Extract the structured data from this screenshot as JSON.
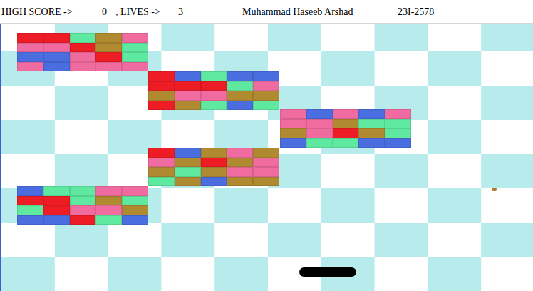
{
  "hud": {
    "high_score_label": "HIGH SCORE ->",
    "high_score": "0",
    "lives_label": ", LIVES ->",
    "lives": "3",
    "player_name": "Muhammad Haseeb Arshad",
    "player_id": "23I-2578"
  },
  "brick_groups": [
    {
      "rows": [
        [
          {
            "color": "#ee1c24"
          },
          {
            "color": "#ee1c24"
          },
          {
            "color": "#5ee8a0"
          },
          {
            "color": "#b08a30"
          },
          {
            "color": "#f06ba0"
          }
        ],
        [
          {
            "color": "#f06ba0"
          },
          {
            "color": "#f06ba0"
          },
          {
            "color": "#ee1c24"
          },
          {
            "color": "#b08a30"
          },
          {
            "color": "#5ee8a0"
          }
        ],
        [
          {
            "color": "#4a6ee0"
          },
          {
            "color": "#4a6ee0"
          },
          {
            "color": "#f06ba0"
          },
          {
            "color": "#ee1c24"
          },
          {
            "color": "#5ee8a0"
          }
        ],
        [
          {
            "color": "#f06ba0"
          },
          {
            "color": "#4a6ee0"
          },
          {
            "color": "#f06ba0"
          },
          {
            "color": "#f06ba0"
          },
          {
            "color": "#f06ba0"
          }
        ]
      ]
    },
    {
      "rows": [
        [
          {
            "color": "#ee1c24"
          },
          {
            "color": "#4a6ee0"
          },
          {
            "color": "#5ee8a0"
          },
          {
            "color": "#4a6ee0"
          },
          {
            "color": "#4a6ee0"
          }
        ],
        [
          {
            "color": "#ee1c24"
          },
          {
            "color": "#ee1c24"
          },
          {
            "color": "#ee1c24"
          },
          {
            "color": "#5ee8a0"
          },
          {
            "color": "#f06ba0"
          }
        ],
        [
          {
            "color": "#b08a30"
          },
          {
            "color": "#f06ba0"
          },
          {
            "color": "#f06ba0"
          },
          {
            "color": "#b08a30"
          },
          {
            "color": "#b08a30"
          }
        ],
        [
          {
            "color": "#ee1c24"
          },
          {
            "color": "#b08a30"
          },
          {
            "color": "#5ee8a0"
          },
          {
            "color": "#4a6ee0"
          },
          {
            "color": "#5ee8a0"
          }
        ]
      ]
    },
    {
      "rows": [
        [
          {
            "color": "#f06ba0"
          },
          {
            "color": "#4a6ee0"
          },
          {
            "color": "#f06ba0"
          },
          {
            "color": "#4a6ee0"
          },
          {
            "color": "#f06ba0"
          }
        ],
        [
          {
            "color": "#f06ba0"
          },
          {
            "color": "#f06ba0"
          },
          {
            "color": "#b08a30"
          },
          {
            "color": "#5ee8a0"
          },
          {
            "color": "#5ee8a0"
          }
        ],
        [
          {
            "color": "#b08a30"
          },
          {
            "color": "#f06ba0"
          },
          {
            "color": "#ee1c24"
          },
          {
            "color": "#b08a30"
          },
          {
            "color": "#5ee8a0"
          }
        ],
        [
          {
            "color": "#4a6ee0"
          },
          {
            "color": "#5ee8a0"
          },
          {
            "color": "#5ee8a0"
          },
          {
            "color": "#4a6ee0"
          },
          {
            "color": "#4a6ee0"
          }
        ]
      ]
    },
    {
      "rows": [
        [
          {
            "color": "#ee1c24"
          },
          {
            "color": "#4a6ee0"
          },
          {
            "color": "#b08a30"
          },
          {
            "color": "#f06ba0"
          },
          {
            "color": "#b08a30"
          }
        ],
        [
          {
            "color": "#f06ba0"
          },
          {
            "color": "#b08a30"
          },
          {
            "color": "#ee1c24"
          },
          {
            "color": "#b08a30"
          },
          {
            "color": "#f06ba0"
          }
        ],
        [
          {
            "color": "#b08a30"
          },
          {
            "color": "#5ee8a0"
          },
          {
            "color": "#b08a30"
          },
          {
            "color": "#f06ba0"
          },
          {
            "color": "#f06ba0"
          }
        ],
        [
          {
            "color": "#5ee8a0"
          },
          {
            "color": "#b08a30"
          },
          {
            "color": "#4a6ee0"
          },
          {
            "color": "#b08a30"
          },
          {
            "color": "#b08a30"
          }
        ]
      ]
    },
    {
      "rows": [
        [
          {
            "color": "#4a6ee0"
          },
          {
            "color": "#5ee8a0"
          },
          {
            "color": "#5ee8a0"
          },
          {
            "color": "#f06ba0"
          },
          {
            "color": "#f06ba0"
          }
        ],
        [
          {
            "color": "#ee1c24"
          },
          {
            "color": "#ee1c24"
          },
          {
            "color": "#5ee8a0"
          },
          {
            "color": "#b08a30"
          },
          {
            "color": "#5ee8a0"
          }
        ],
        [
          {
            "color": "#5ee8a0"
          },
          {
            "color": "#ee1c24"
          },
          {
            "color": "#f06ba0"
          },
          {
            "color": "#f06ba0"
          },
          {
            "color": "#b08a30"
          }
        ],
        [
          {
            "color": "#4a6ee0"
          },
          {
            "color": "#4a6ee0"
          },
          {
            "color": "#ee1c24"
          },
          {
            "color": "#5ee8a0"
          },
          {
            "color": "#4a6ee0"
          }
        ]
      ]
    }
  ]
}
